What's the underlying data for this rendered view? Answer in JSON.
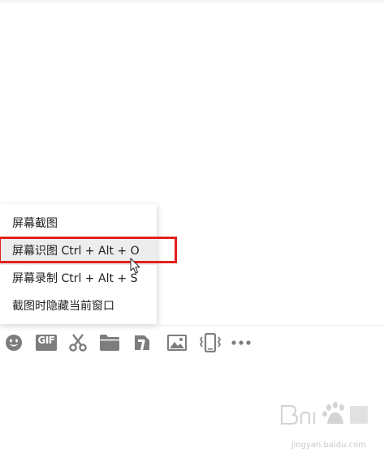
{
  "menu": {
    "items": [
      {
        "label": "屏幕截图"
      },
      {
        "label": "屏幕识图 Ctrl + Alt + O",
        "highlighted": true
      },
      {
        "label": "屏幕录制 Ctrl + Alt + S"
      },
      {
        "label": "截图时隐藏当前窗口"
      }
    ]
  },
  "toolbar": {
    "icons": [
      "emoji-icon",
      "gif-icon",
      "scissors-icon",
      "folder-icon",
      "pin-icon",
      "image-icon",
      "shake-icon",
      "more-icon"
    ],
    "gif_label": "GIF",
    "icon_color": "#7d7d7d"
  },
  "watermark": {
    "url": "jingyan.baidu.com"
  },
  "colors": {
    "highlight_border": "#e0211b",
    "menu_hover": "#ededed"
  }
}
